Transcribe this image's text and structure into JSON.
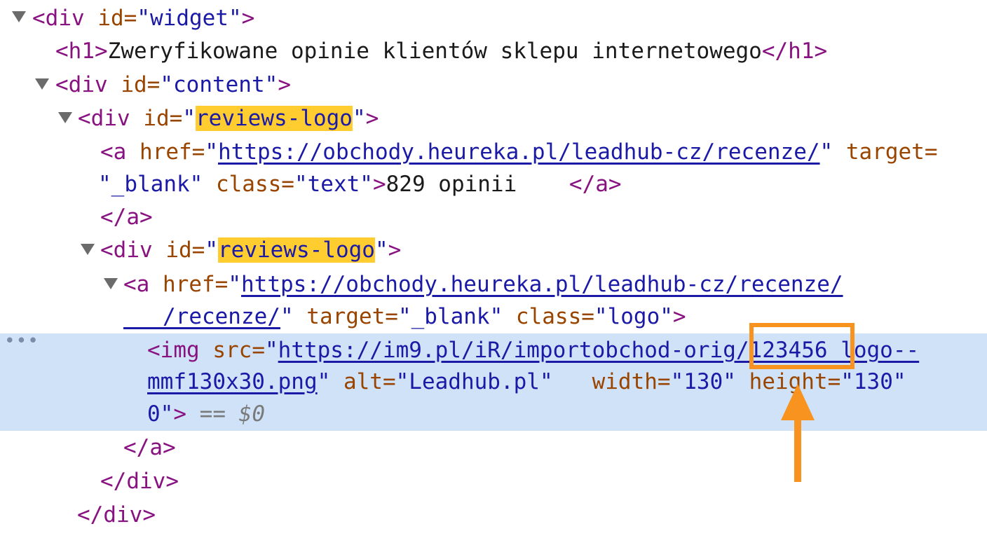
{
  "lines": {
    "l1": {
      "open": "<div ",
      "attr": "id=",
      "val": "\"widget\"",
      "close": ">"
    },
    "l2": {
      "open": "<h1>",
      "text": "Zweryfikowane opinie klientów sklepu internetowego",
      "close": "</h1>"
    },
    "l3": {
      "open": "<div ",
      "attr": "id=",
      "val": "\"content\"",
      "close": ">"
    },
    "l4": {
      "open": "<div ",
      "attr": "id=",
      "q1": "\"",
      "hl": "reviews-logo",
      "q2": "\"",
      "close": ">"
    },
    "l5": {
      "open": "<a ",
      "attr": "href=",
      "q1": "\"",
      "link": "https://obchody.heureka.pl/leadhub-cz/recenze/",
      "q2": "\"",
      "attr2": " target="
    },
    "l6": {
      "val": "\"_blank\"",
      "attr": " class=",
      "val2": "\"text\"",
      "mid": ">",
      "text": "829 opinii    ",
      "close": "</a>"
    },
    "l7": {
      "close": "</a>"
    },
    "l8": {
      "open": "<div ",
      "attr": "id=",
      "q1": "\"",
      "hl": "reviews-logo",
      "q2": "\"",
      "close": ">"
    },
    "l9": {
      "open": "<a ",
      "attr": "href=",
      "q1": "\"",
      "link": "https://obchody.heureka.pl/leadhub-cz/recenze/"
    },
    "l10": {
      "link": "   /recenze/",
      "q2": "\"",
      "attr": " target=",
      "val": "\"_blank\"",
      "attr2": " class=",
      "val2": "\"logo\"",
      "close": ">"
    },
    "l11": {
      "open": "<img ",
      "attr": "src=",
      "q1": "\"",
      "link": "https://im9.pl/iR/importobchod-orig/123456 logo--"
    },
    "l12": {
      "link": "mmf130x30.png",
      "q2": "\"",
      "attr": " alt=",
      "val": "\"Leadhub.pl\"",
      "attr2": "   width=",
      "val2": "\"130\"",
      "attr3": " height=",
      "val3": "\"130\""
    },
    "l13": {
      "val": "0\"",
      "close": ">",
      "eq": " == $0"
    },
    "l14": {
      "close": "</a>"
    },
    "l15": {
      "close": "</div>"
    },
    "l16": {
      "close": "</div>"
    }
  },
  "row_menu": "•••",
  "colors": {
    "selected_row": "#cfe2f8",
    "highlight": "#ffcd30",
    "annotation": "#f7931e"
  }
}
